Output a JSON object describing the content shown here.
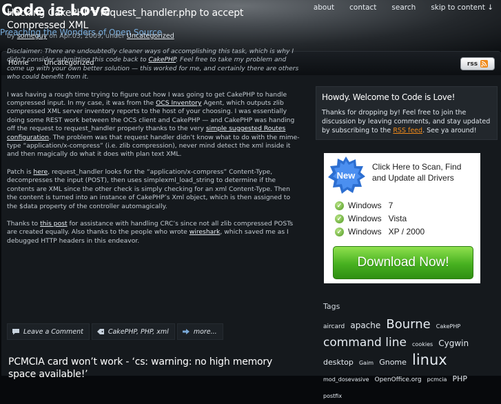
{
  "site": {
    "title": "Code is Love",
    "tagline": "Preaching the Wonders of Open Source"
  },
  "top_nav": [
    "about",
    "contact",
    "search",
    "skip to content ↓"
  ],
  "menu": {
    "items": [
      "Home",
      "Uncategorized"
    ],
    "rss_label": "rss"
  },
  "post": {
    "title": "Hacking CakePHP’s request_handler.php to accept Compressed XML",
    "meta_by": "by",
    "author": "someguy",
    "meta_date": "on Apr.03, 2009, under",
    "category": "Uncategorized",
    "disclaimer_1": "Disclaimer: There are undoubtedly cleaner ways of accomplishing this task, which is why I didn’t consider submitting this code back to",
    "disclaimer_link": "CakePHP",
    "disclaimer_2": ". Feel free to take my problem and come up with your own better solution — this worked for me, and certainly there are others who could benefit from it.",
    "p1_a": "I was having a rough time trying to figure out how I was going to get CakePHP to handle compressed input. In my case, it was from the",
    "p1_link1": "OCS Inventory",
    "p1_b": "Agent, which outputs zlib compressed XML server inventory reports to the host of your choosing. I was essentially doing some REST work between the OCS client and CakePHP — and CakePHP was handing off the request to request_handler properly thanks to the very",
    "p1_link2": "simple suggested Routes configuration",
    "p1_c": ". The problem was that request handler didn’t know what to do with the mime-type “application/x-compress” (i.e. zlib compression), never mind detect the xml inside it and then magically do what it does with plan text XML.",
    "p2_a": "Patch is",
    "p2_link": "here",
    "p2_b": ", request_handler looks for the “application/x-compress” Content-Type, decompresses the input (POST), then uses simplexml_load_string to determine if the contents are XML since the other check is simply checking for an xml Content-Type. Then the content is turned into an instance of CakePHP’s Xml object, which is then assigned to the $data property of the controller automagically.",
    "p3_a": "Thanks to",
    "p3_link1": "this post",
    "p3_b": "for assistance with handling CRC’s since not all zlib compressed POSTs are created equally. Also thanks to the people who wrote",
    "p3_link2": "wireshark",
    "p3_c": ", which saved me as I debugged HTTP headers in this endeavor.",
    "footer": {
      "comment": "Leave a Comment",
      "tags": "CakePHP, PHP, xml",
      "more": "more..."
    }
  },
  "post2": {
    "title": "PCMCIA card won’t work - ‘cs: warning: no high memory space available!’"
  },
  "welcome": {
    "title": "Howdy. Welcome to Code is Love!",
    "text_a": "Thanks for dropping by! Feel free to join the discussion by leaving comments, and stay updated by subscribing to the",
    "rss_link": "RSS feed",
    "text_b": ". See ya around!"
  },
  "ad": {
    "badge": "New",
    "headline": "Click Here to Scan, Find and Update all Drivers",
    "rows": [
      "Windows   7",
      "Windows   Vista",
      "Windows   XP / 2000"
    ],
    "button": "Download Now!"
  },
  "tags": {
    "title": "Tags",
    "items": [
      {
        "label": "aircard",
        "size": 9
      },
      {
        "label": "apache",
        "size": 12
      },
      {
        "label": "Bourne",
        "size": 18
      },
      {
        "label": "CakePHP",
        "size": 8
      },
      {
        "label": "command line",
        "size": 17
      },
      {
        "label": "cookies",
        "size": 8
      },
      {
        "label": "Cygwin",
        "size": 12
      },
      {
        "label": "desktop",
        "size": 11
      },
      {
        "label": "Gaim",
        "size": 8
      },
      {
        "label": "Gnome",
        "size": 11
      },
      {
        "label": "linux",
        "size": 21
      },
      {
        "label": "mod_dosevasive",
        "size": 8
      },
      {
        "label": "OpenOffice.org",
        "size": 9
      },
      {
        "label": "pcmcia",
        "size": 8
      },
      {
        "label": "PHP",
        "size": 11
      },
      {
        "label": "postfix",
        "size": 8
      }
    ]
  },
  "colors": {
    "accent_link": "#e8eef4",
    "tagline": "#79aede",
    "rss_orange": "#f08a1a",
    "download_green": "#47b020"
  }
}
